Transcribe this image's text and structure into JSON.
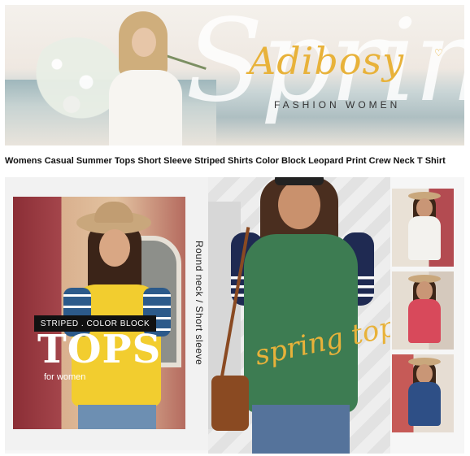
{
  "banner": {
    "script_text": "Spring",
    "brand": "Adibosy",
    "subtitle": "FASHION WOMEN"
  },
  "product": {
    "title": "Womens Casual Summer Tops Short Sleeve Striped Shirts Color Block Leopard Print Crew Neck T Shirt"
  },
  "collage": {
    "label": "STRIPED . COLOR BLOCK",
    "headline": "TOPS",
    "headline_sub": "for women",
    "vertical_text": "Round neck / Short sleeve",
    "script_text": "spring tops"
  },
  "thumbnails": [
    {
      "shirt_color": "#f3f2ee",
      "name": "white-navy-tee"
    },
    {
      "shirt_color": "#d8495b",
      "name": "red-navy-tee"
    },
    {
      "shirt_color": "#2e4f86",
      "name": "navy-white-tee"
    }
  ],
  "colors": {
    "brand_gold": "#e8b23a",
    "green_tee": "#3d7c52",
    "navy_sleeve": "#1f2a52",
    "yellow_tee": "#f2cd2f"
  }
}
